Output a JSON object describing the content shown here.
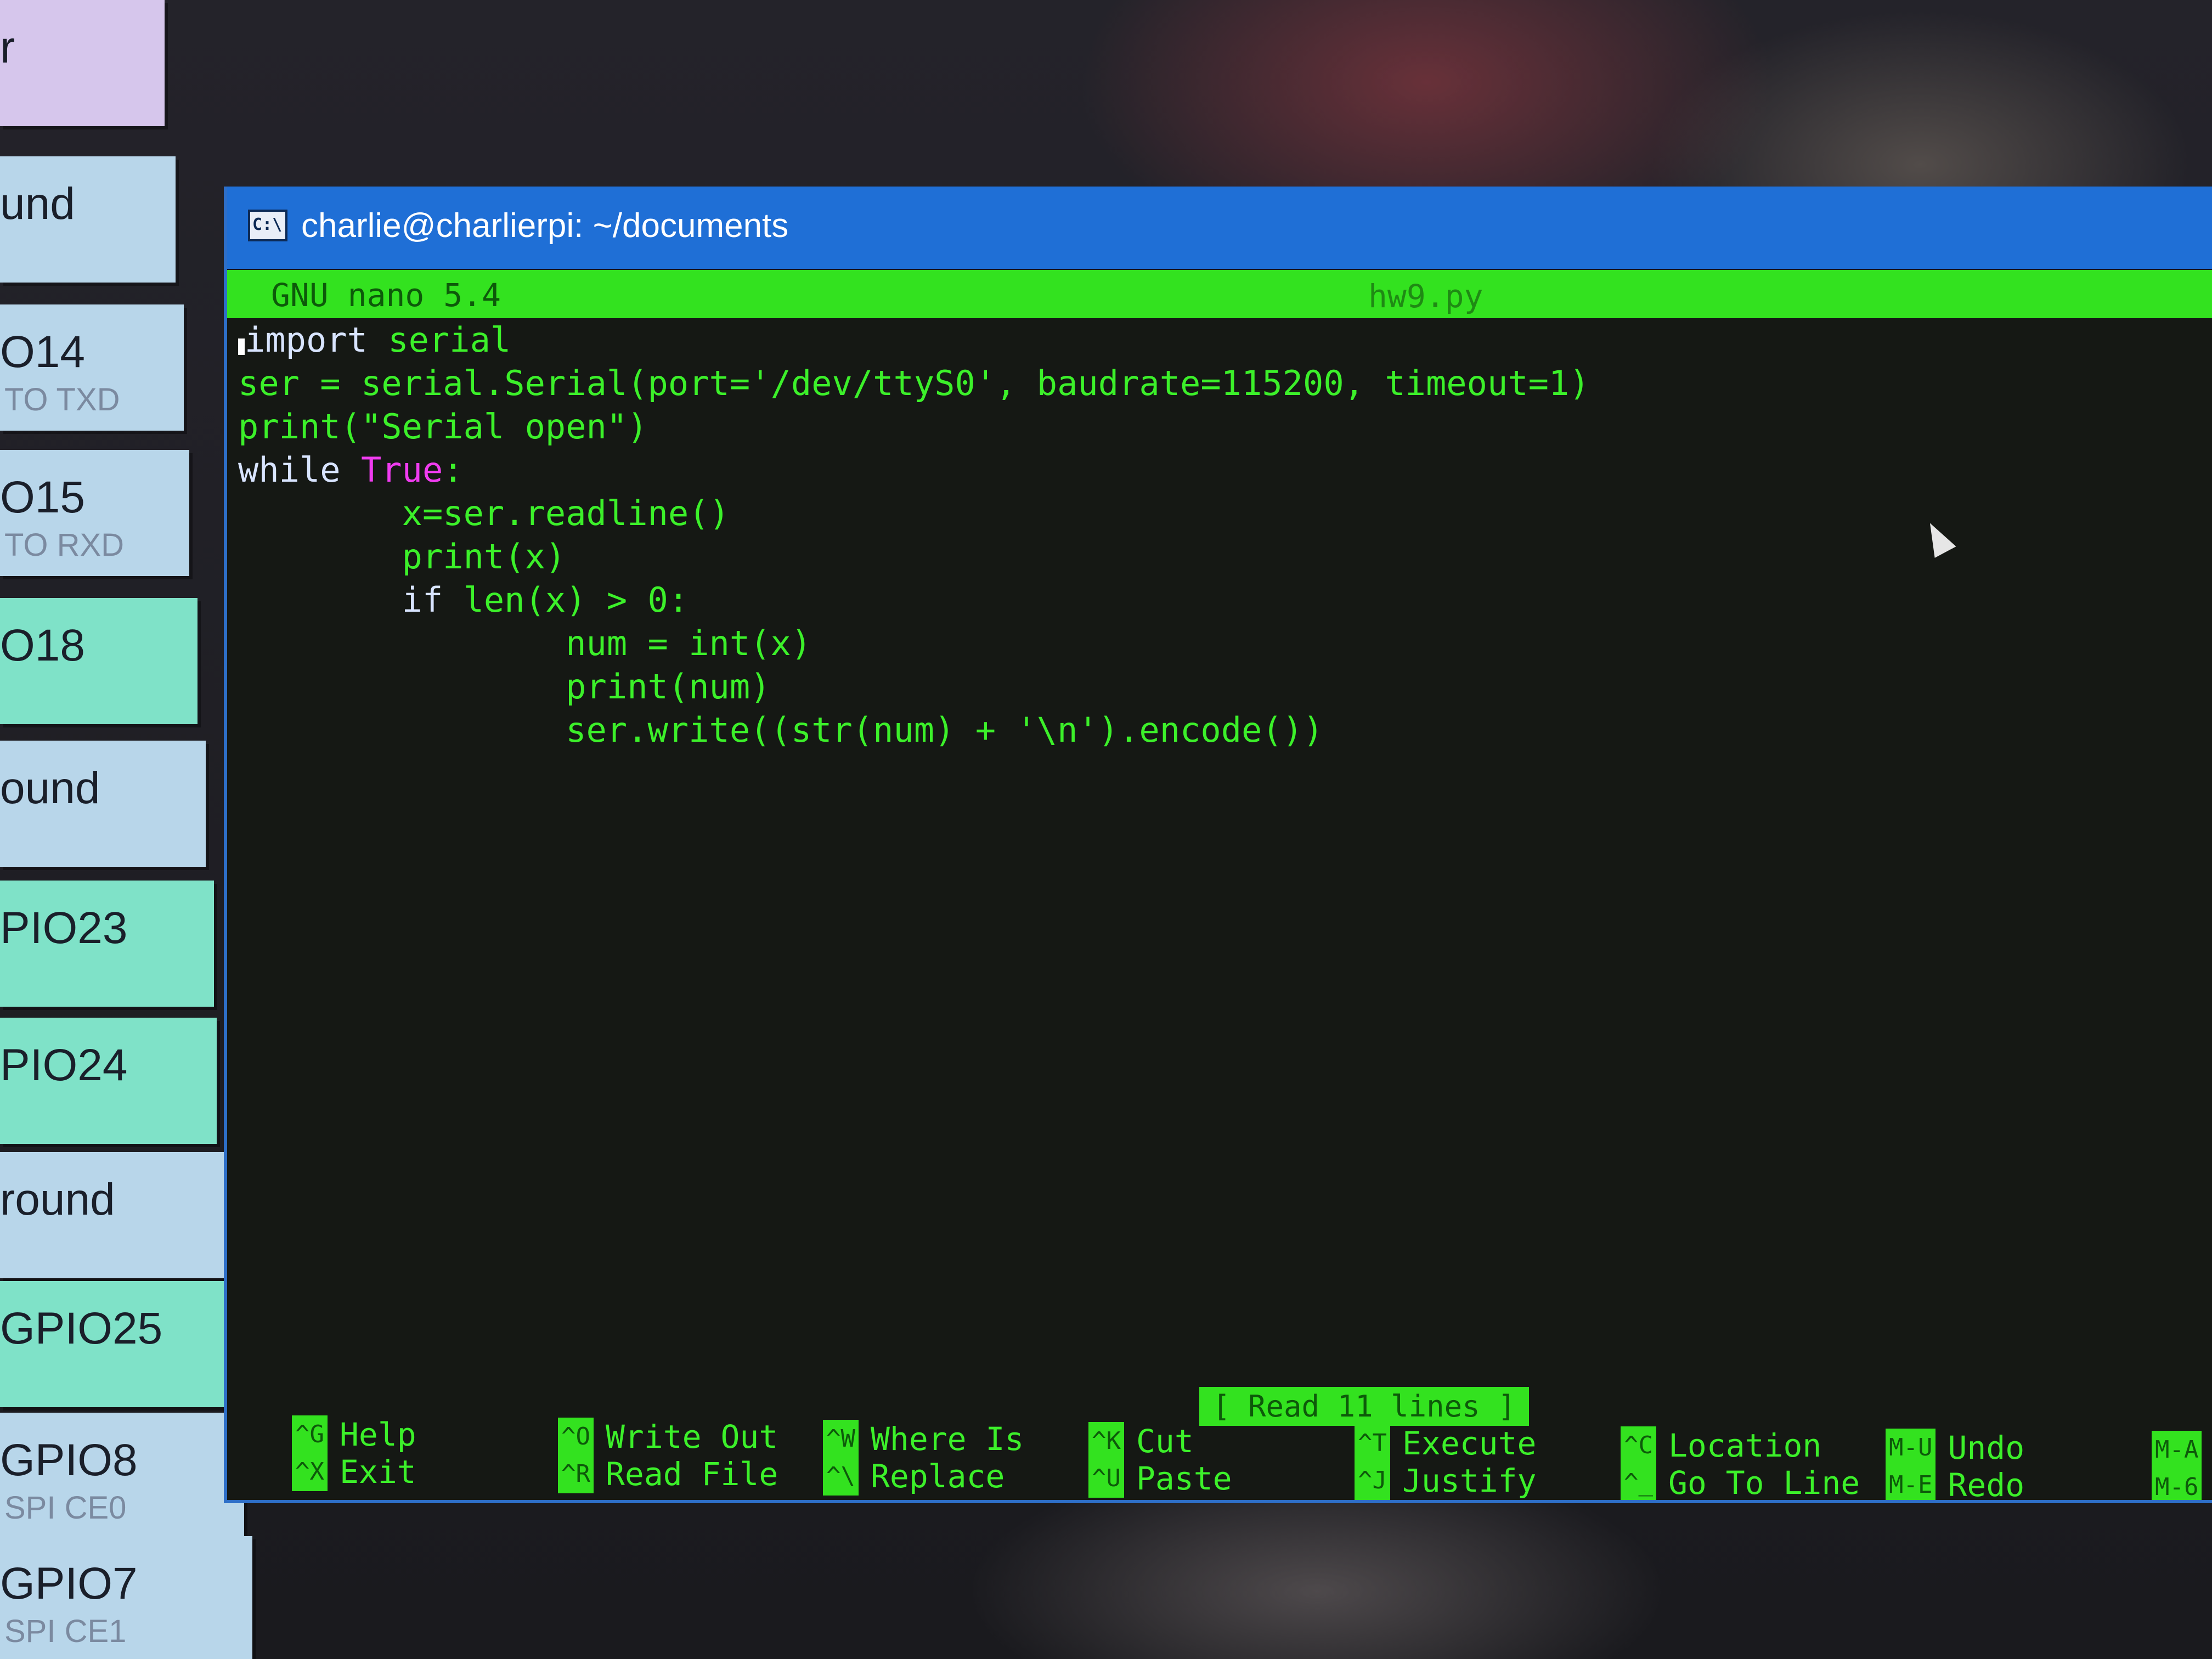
{
  "pinout_panel": {
    "items": [
      {
        "name": "r",
        "sub": ""
      },
      {
        "name": "und",
        "sub": ""
      },
      {
        "name": "O14",
        "sub": "TO TXD"
      },
      {
        "name": "O15",
        "sub": "TO RXD"
      },
      {
        "name": "O18",
        "sub": ""
      },
      {
        "name": "ound",
        "sub": ""
      },
      {
        "name": "PIO23",
        "sub": ""
      },
      {
        "name": "PIO24",
        "sub": ""
      },
      {
        "name": "round",
        "sub": ""
      },
      {
        "name": "GPIO25",
        "sub": ""
      },
      {
        "name": "GPIO8",
        "sub": "SPI CE0"
      },
      {
        "name": "GPIO7",
        "sub": "SPI CE1"
      }
    ]
  },
  "window": {
    "title": "charlie@charlierpi: ~/documents",
    "icon": "terminal-icon"
  },
  "nano": {
    "version": "GNU nano 5.4",
    "filename": "hw9.py",
    "status": "[ Read 11 lines ]",
    "code_lines": [
      [
        {
          "t": "import",
          "c": "kw"
        },
        {
          "t": " serial",
          "c": ""
        }
      ],
      [
        {
          "t": "ser = serial.Serial(port='/dev/ttyS0', baudrate=115200, timeout=1)",
          "c": ""
        }
      ],
      [
        {
          "t": "print(\"Serial open\")",
          "c": ""
        }
      ],
      [
        {
          "t": "while",
          "c": "kw"
        },
        {
          "t": " ",
          "c": ""
        },
        {
          "t": "True",
          "c": "kw2"
        },
        {
          "t": ":",
          "c": ""
        }
      ],
      [
        {
          "t": "        x=ser.readline()",
          "c": ""
        }
      ],
      [
        {
          "t": "        print(x)",
          "c": ""
        }
      ],
      [
        {
          "t": "        ",
          "c": ""
        },
        {
          "t": "if",
          "c": "kw"
        },
        {
          "t": " len(x) > 0:",
          "c": ""
        }
      ],
      [
        {
          "t": "                num = int(x)",
          "c": ""
        }
      ],
      [
        {
          "t": "                print(num)",
          "c": ""
        }
      ],
      [
        {
          "t": "                ser.write((str(num) + '\\n').encode())",
          "c": ""
        }
      ]
    ],
    "shortcuts": [
      {
        "key": "^G",
        "label": "Help"
      },
      {
        "key": "^X",
        "label": "Exit"
      },
      {
        "key": "^O",
        "label": "Write Out"
      },
      {
        "key": "^R",
        "label": "Read File"
      },
      {
        "key": "^W",
        "label": "Where Is"
      },
      {
        "key": "^\\",
        "label": "Replace"
      },
      {
        "key": "^K",
        "label": "Cut"
      },
      {
        "key": "^U",
        "label": "Paste"
      },
      {
        "key": "^T",
        "label": "Execute"
      },
      {
        "key": "^J",
        "label": "Justify"
      },
      {
        "key": "^C",
        "label": "Location"
      },
      {
        "key": "^_",
        "label": "Go To Line"
      },
      {
        "key": "M-U",
        "label": "Undo"
      },
      {
        "key": "M-E",
        "label": "Redo"
      },
      {
        "key": "M-A",
        "label": ""
      },
      {
        "key": "M-6",
        "label": ""
      }
    ]
  },
  "colors": {
    "titlebar": "#1f6fd6",
    "nano_bar": "#33e21f",
    "text": "#3cf02a",
    "keyword": "#d8e4ff",
    "constant": "#f03cf0"
  }
}
